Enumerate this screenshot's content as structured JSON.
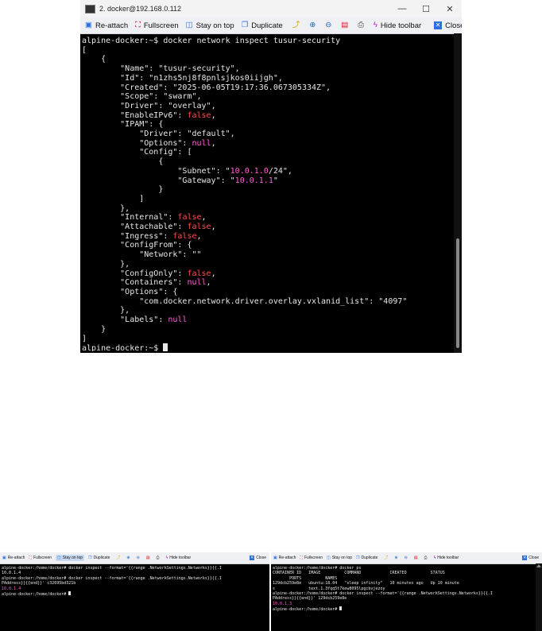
{
  "main_window": {
    "title": "2. docker@192.168.0.112",
    "controls": {
      "minimize": "—",
      "maximize": "☐",
      "close": "✕"
    },
    "toolbar": {
      "reattach": "Re-attach",
      "fullscreen": "Fullscreen",
      "stay_on_top": "Stay on top",
      "duplicate": "Duplicate",
      "hide_toolbar": "Hide toolbar",
      "close": "Close"
    },
    "prompt": "alpine-docker:~$ ",
    "command": "docker network inspect tusur-security",
    "output": {
      "name": "\"tusur-security\"",
      "id": "\"n1zhs5nj8f8pnlsjkos0iijgh\"",
      "created": "\"2025-06-05T19:17:36.067305334Z\"",
      "scope": "\"swarm\"",
      "driver": "\"overlay\"",
      "enable_ipv6": "false",
      "ipam_driver": "\"default\"",
      "ipam_options": "null",
      "subnet_a": "\"",
      "subnet_num": "10.0.1.0",
      "subnet_b": "/24\"",
      "gateway_a": "\"",
      "gateway_num": "10.0.1.1",
      "gateway_b": "\"",
      "internal": "false",
      "attachable": "false",
      "ingress": "false",
      "network": "\"\"",
      "config_only": "false",
      "containers": "null",
      "vxlan_key": "\"com.docker.network.driver.overlay.vxlanid_list\"",
      "vxlan_val": "\"4097\"",
      "labels": "null"
    },
    "final_prompt": "alpine-docker:~$ "
  },
  "left_window": {
    "toolbar": {
      "reattach": "Re-attach",
      "fullscreen": "Fullscreen",
      "stay_on_top": "Stay on top",
      "duplicate": "Duplicate",
      "hide_toolbar": "Hide toolbar",
      "close": "Close"
    },
    "lines": {
      "l1": "alpine-docker:/home/docker# docker inspect --format='{{range .NetworkSettings.Networks}}{{.I",
      "l2": "10.0.1.4",
      "l3": "alpine-docker:/home/docker# docker inspect --format='{{range .NetworkSettings.Networks}}{{.I",
      "l4": "PAddress}}{{end}}' c32695bd321b",
      "l5": "10.0.1.4",
      "l6": "alpine-docker:/home/docker# "
    }
  },
  "right_window": {
    "toolbar": {
      "reattach": "Re-attach",
      "fullscreen": "Fullscreen",
      "stay_on_top": "Stay on top",
      "duplicate": "Duplicate",
      "hide_toolbar": "Hide toolbar",
      "close": "Close"
    },
    "lines": {
      "l1": "alpine-docker:/home/docker# docker ps",
      "l2": "CONTAINER ID   IMAGE          COMMAND            CREATED          STATUS",
      "l3": "       PORTS          NAMES",
      "l4": "129dcb259e8e   ubuntu:18.04   \"sleep infinity\"   10 minutes ago   Up 10 minute",
      "l5": "s              text.1.3fqq5t7kew8095lpgcbvjezoy",
      "l6": "alpine-docker:/home/docker# docker inspect --format='{{range .NetworkSettings.Networks}}{{.I",
      "l7": "PAddress}}{{end}}' 129dcb259e8e",
      "l8": "10.0.1.3",
      "l9": "alpine-docker:/home/docker# "
    }
  },
  "colors": {
    "keyword": "#ff4d4d",
    "number": "#ff5fd7",
    "text": "#e8e8e8",
    "background": "#000000"
  }
}
